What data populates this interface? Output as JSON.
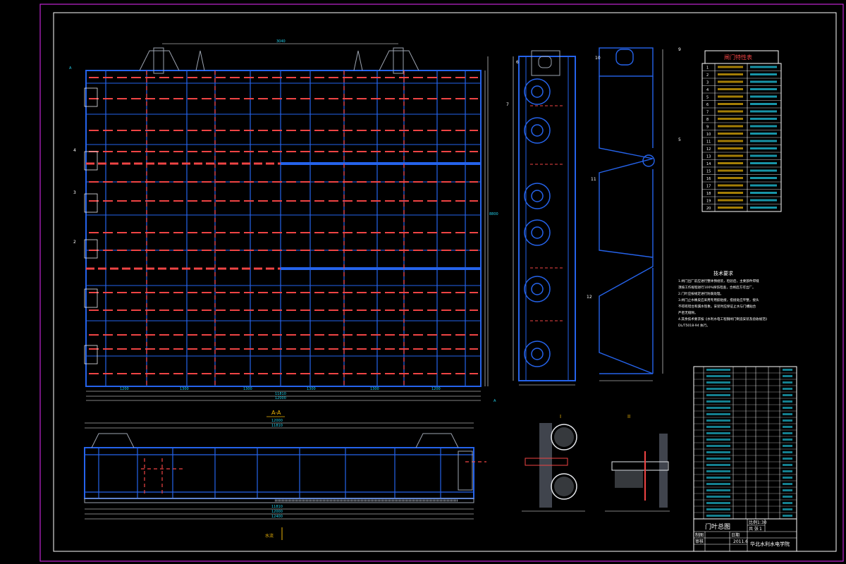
{
  "drawing": {
    "view_titles": {
      "section_aa": "A-A",
      "detail_1": "I",
      "detail_2": "II",
      "upstream": "水流"
    },
    "spec_table": {
      "title": "闸门特性表",
      "rows": [
        "1",
        "2",
        "3",
        "4",
        "5",
        "6",
        "7",
        "8",
        "9",
        "10",
        "11",
        "12",
        "13",
        "14",
        "15",
        "16",
        "17",
        "18",
        "19",
        "20"
      ]
    },
    "tech_requirements": {
      "title": "技术要求",
      "lines": [
        "1.闸门出厂前应进行整体预组装，检验后，主要部件焊缝",
        "  须按工作规程进行100%探伤检查，合格后方可出厂。",
        "2.门叶应按规定进行防腐处理。",
        "3.闸门止水橡皮应采用专用胶粘接，搭接处应平整，接头",
        "  不得有错台和漏水现象。安装时应保证止水与门槽贴合",
        "  严密无缝隙。",
        "4.其余技术要求按《水利水电工程钢闸门制造安装及验收规范》",
        "  DL/T5018-94 执行。"
      ]
    },
    "title_block": {
      "drawing_name": "门叶总图",
      "scale_label": "比例",
      "scale_value": "1:30",
      "sheet_label": "共 张",
      "sheet_value": "1",
      "school": "华北水利水电学院",
      "year": "2011.6",
      "role_1": "制图",
      "role_2": "审核",
      "role_3": "日期"
    }
  }
}
